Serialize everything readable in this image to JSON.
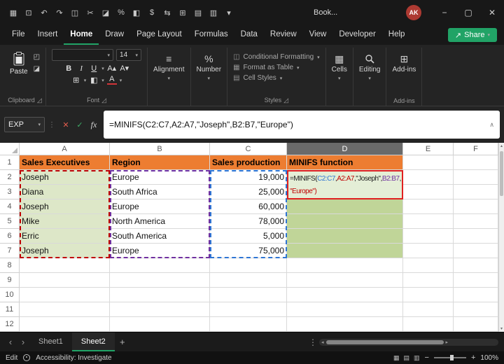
{
  "colors": {
    "accent_green": "#21a366",
    "header_orange": "#ed7d31",
    "name_column_fill": "#dde7c8",
    "result_column_fill": "#c0d598",
    "formula_cell_fill": "#e4eed6",
    "formula_border_red": "#e02020",
    "ref_blue": "#2e75d4",
    "ref_red": "#c00000",
    "ref_purple": "#7030a0",
    "avatar_red": "#ad3a32"
  },
  "titlebar": {
    "title": "Book...",
    "avatar_initials": "AK",
    "quick_access_icons": [
      {
        "name": "excel-app-icon",
        "glyph": "▦"
      },
      {
        "name": "save-icon",
        "glyph": "⊡"
      },
      {
        "name": "undo-icon",
        "glyph": "↶"
      },
      {
        "name": "redo-icon",
        "glyph": "↷"
      },
      {
        "name": "clipboard-icon",
        "glyph": "◫"
      },
      {
        "name": "cut-icon",
        "glyph": "✂"
      },
      {
        "name": "format-painter-icon",
        "glyph": "◪"
      },
      {
        "name": "percent-style-icon",
        "glyph": "%"
      },
      {
        "name": "fill-color-icon",
        "glyph": "◧"
      },
      {
        "name": "currency-style-icon",
        "glyph": "$"
      },
      {
        "name": "merge-center-icon",
        "glyph": "⇆"
      },
      {
        "name": "borders-icon",
        "glyph": "⊞"
      },
      {
        "name": "insert-table-icon",
        "glyph": "▤"
      },
      {
        "name": "insert-chart-icon",
        "glyph": "▥"
      },
      {
        "name": "qat-customize-icon",
        "glyph": "▾"
      }
    ],
    "window_controls": {
      "minimize": "−",
      "maximize": "▢",
      "close": "✕"
    }
  },
  "menubar": {
    "items": [
      "File",
      "Insert",
      "Home",
      "Draw",
      "Page Layout",
      "Formulas",
      "Data",
      "Review",
      "View",
      "Developer",
      "Help"
    ],
    "active_item": "Home",
    "share": {
      "icon": "↗",
      "label": "Share",
      "chevron": "▾"
    }
  },
  "ribbon": {
    "chevron": "▾",
    "launcher": "◿",
    "icons": {
      "copy": "◰",
      "painter": "◪",
      "grow_font": "A▴",
      "shrink_font": "A▾",
      "borders": "⊞",
      "fill_color": "◧",
      "font_color": "A",
      "align": "≡",
      "percent": "%",
      "cells": "▦",
      "addins": "⊞"
    },
    "clipboard": {
      "paste_label": "Paste",
      "group_label": "Clipboard"
    },
    "font": {
      "group_label": "Font",
      "font_name": "",
      "font_size": "14",
      "bold": "B",
      "italic": "I",
      "underline": "U"
    },
    "alignment": {
      "label": "Alignment"
    },
    "number": {
      "label": "Number"
    },
    "styles": {
      "group_label": "Styles",
      "icons": [
        "◫",
        "▦",
        "▤"
      ],
      "items": [
        "Conditional Formatting",
        "Format as Table",
        "Cell Styles"
      ]
    },
    "cells": {
      "label": "Cells"
    },
    "editing": {
      "label": "Editing"
    },
    "addins": {
      "button_label": "Add-ins",
      "group_label": "Add-ins"
    }
  },
  "formula_bar": {
    "name_box_value": "EXP",
    "chevron": "▾",
    "separator": "⋮",
    "cancel": "✕",
    "enter": "✓",
    "insert_function": "fx",
    "collapse": "∧",
    "formula": "=MINIFS(C2:C7,A2:A7,\"Joseph\",B2:B7,\"Europe\")"
  },
  "grid": {
    "column_headers": [
      "A",
      "B",
      "C",
      "D",
      "E",
      "F"
    ],
    "selected_column": "D",
    "row_headers": [
      "1",
      "2",
      "3",
      "4",
      "5",
      "6",
      "7",
      "8",
      "9",
      "10",
      "11",
      "12"
    ],
    "header_row": {
      "A": "Sales Executives",
      "B": "Region",
      "C": "Sales production",
      "D": "MINIFS function"
    },
    "data_rows": [
      {
        "executive": "Joseph",
        "region": "Europe",
        "sales": "19,000"
      },
      {
        "executive": "Diana",
        "region": "South Africa",
        "sales": "25,000"
      },
      {
        "executive": "Joseph",
        "region": "Europe",
        "sales": "60,000"
      },
      {
        "executive": "Mike",
        "region": "North America",
        "sales": "78,000"
      },
      {
        "executive": "Erric",
        "region": "South America",
        "sales": "5,000"
      },
      {
        "executive": "Joseph",
        "region": "Europe",
        "sales": "75,000"
      }
    ],
    "formula_cell": {
      "lines": [
        [
          {
            "text": "=MINIFS(",
            "color": "#1a1a1a"
          },
          {
            "text": "C2:C7",
            "color": "#2e75d4"
          },
          {
            "text": ",",
            "color": "#1a1a1a"
          },
          {
            "text": "A2:A7",
            "color": "#c00000"
          },
          {
            "text": ",\"Joseph\",",
            "color": "#1a1a1a"
          },
          {
            "text": "B2:B7",
            "color": "#7030a0"
          },
          {
            "text": ",",
            "color": "#1a1a1a"
          }
        ],
        [
          {
            "text": "\"Europe\")",
            "color": "#c00000"
          }
        ]
      ]
    },
    "scroll_up": "▴",
    "scroll_down": "▾"
  },
  "sheet_tabs": {
    "nav_left": "‹",
    "nav_right": "›",
    "tabs": [
      {
        "label": "Sheet1",
        "active": false
      },
      {
        "label": "Sheet2",
        "active": true
      }
    ],
    "add_sheet": "+",
    "tab_menu": "⋮",
    "hscroll_left": "◂",
    "hscroll_right": "▸"
  },
  "status_bar": {
    "mode": "Edit",
    "accessibility": "Accessibility: Investigate",
    "view_icons": [
      {
        "name": "normal-view-icon",
        "glyph": "▦"
      },
      {
        "name": "page-layout-view-icon",
        "glyph": "▤"
      },
      {
        "name": "page-break-preview-icon",
        "glyph": "▥"
      }
    ],
    "zoom_out": "−",
    "zoom_in": "+",
    "zoom_level": "100%"
  }
}
